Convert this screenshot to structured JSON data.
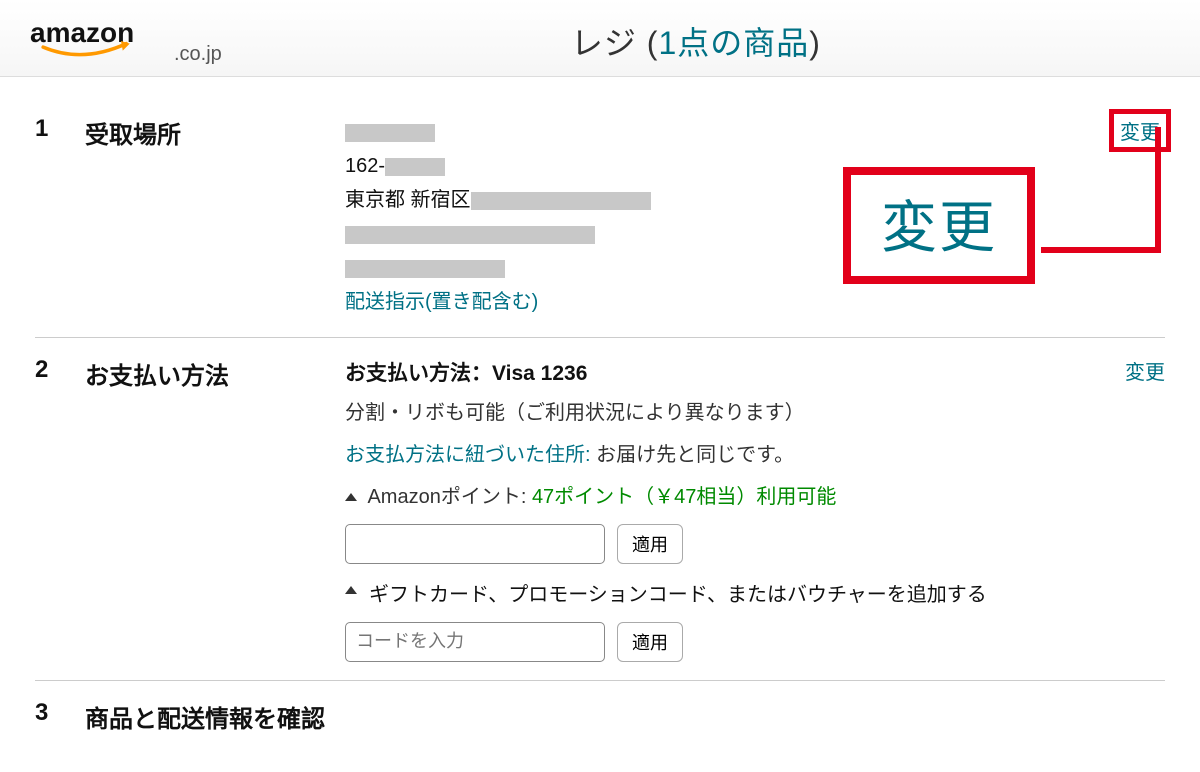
{
  "header": {
    "logo_tld": ".co.jp",
    "title_prefix": "レジ (",
    "title_count": "1点の商品",
    "title_suffix": ")"
  },
  "sections": {
    "s1": {
      "num": "1",
      "label": "受取場所",
      "postal_prefix": "162-",
      "city_prefix": "東京都 新宿区",
      "delivery_link": "配送指示(置き配含む)",
      "change": "変更"
    },
    "s2": {
      "num": "2",
      "label": "お支払い方法",
      "method_title": "お支払い方法：Visa 1236",
      "installment_note": "分割・リボも可能（ご利用状況により異なります）",
      "billing_label": "お支払方法に紐づいた住所:",
      "billing_value": " お届け先と同じです。",
      "points_label": "Amazonポイント: ",
      "points_value": "47ポイント（￥47相当）利用可能",
      "apply1": "適用",
      "gift_label": "ギフトカード、プロモーションコード、またはバウチャーを追加する",
      "code_placeholder": "コードを入力",
      "apply2": "適用",
      "change": "変更"
    },
    "s3": {
      "num": "3",
      "label": "商品と配送情報を確認"
    }
  },
  "annotation": {
    "big_text": "変更"
  }
}
